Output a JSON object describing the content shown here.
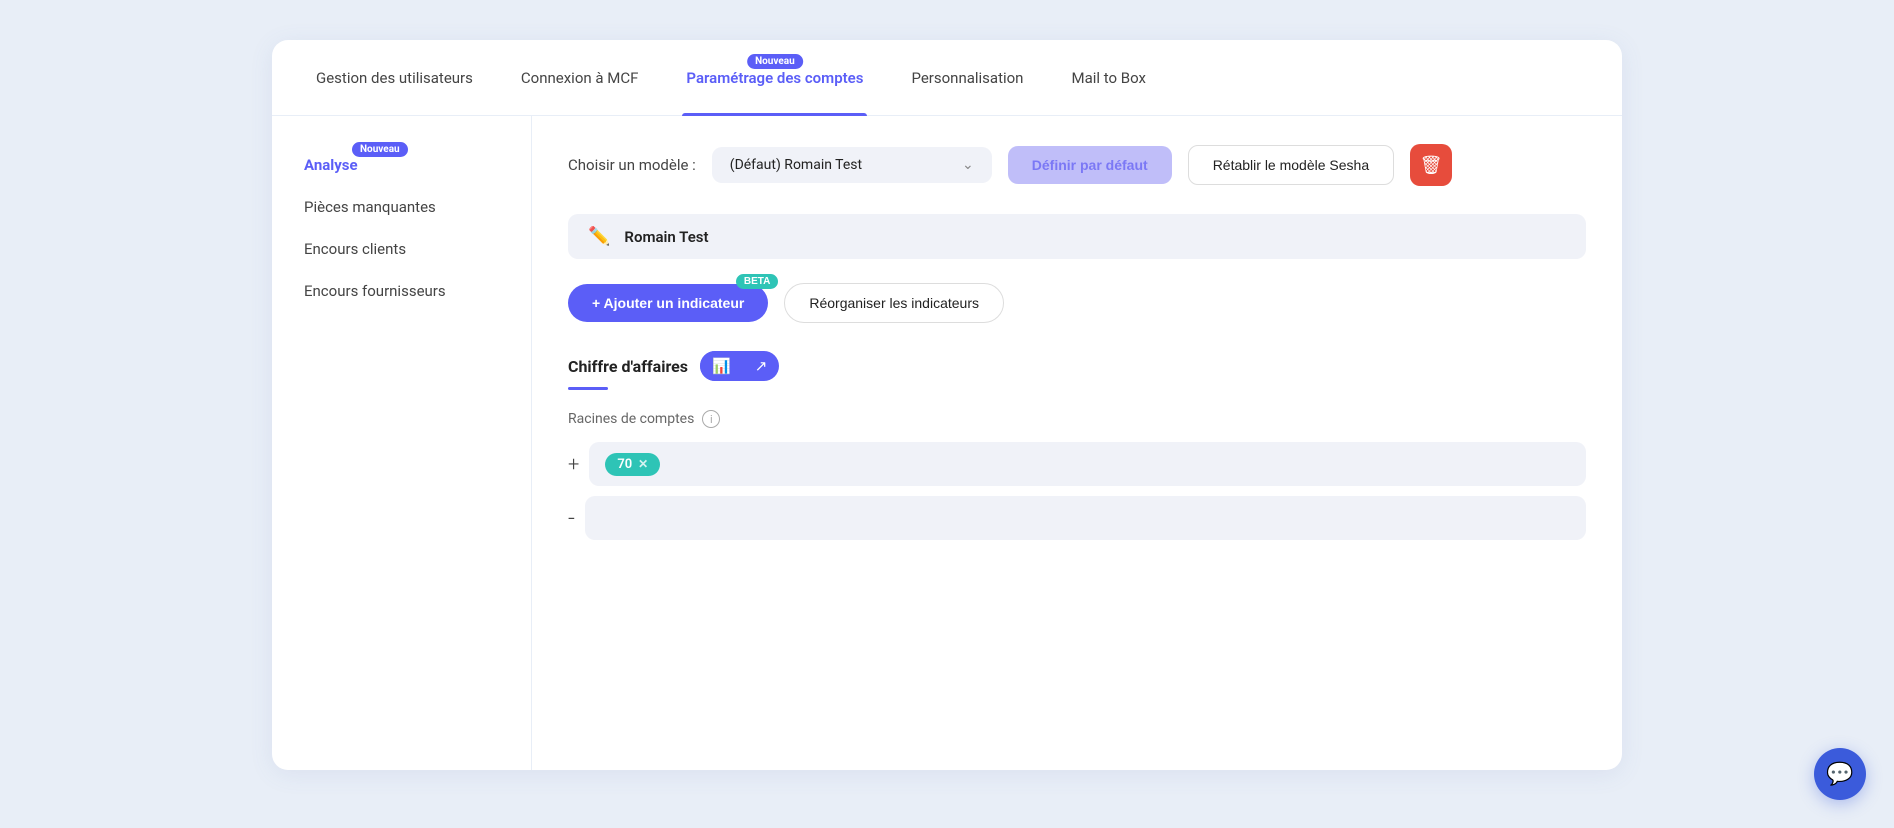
{
  "nav": {
    "items": [
      {
        "id": "gestion",
        "label": "Gestion des utilisateurs",
        "active": false,
        "badge": null
      },
      {
        "id": "connexion",
        "label": "Connexion à MCF",
        "active": false,
        "badge": null
      },
      {
        "id": "parametrage",
        "label": "Paramétrage des comptes",
        "active": true,
        "badge": "Nouveau"
      },
      {
        "id": "personnalisation",
        "label": "Personnalisation",
        "active": false,
        "badge": null
      },
      {
        "id": "mailtobox",
        "label": "Mail to Box",
        "active": false,
        "badge": null
      }
    ]
  },
  "sidebar": {
    "items": [
      {
        "id": "analyse",
        "label": "Analyse",
        "active": true,
        "badge": "Nouveau"
      },
      {
        "id": "pieces",
        "label": "Pièces manquantes",
        "active": false,
        "badge": null
      },
      {
        "id": "encours-clients",
        "label": "Encours clients",
        "active": false,
        "badge": null
      },
      {
        "id": "encours-fournisseurs",
        "label": "Encours fournisseurs",
        "active": false,
        "badge": null
      }
    ]
  },
  "model_section": {
    "label": "Choisir un modèle :",
    "selected": "(Défaut) Romain Test",
    "btn_set_default": "Définir par défaut",
    "btn_restore": "Rétablir le modèle Sesha",
    "btn_delete_icon": "🗑"
  },
  "name_field": {
    "value": "Romain Test",
    "edit_icon": "✏"
  },
  "actions": {
    "add_indicator": "+ Ajouter un indicateur",
    "add_indicator_badge": "BETA",
    "reorganize": "Réorganiser les indicateurs"
  },
  "section": {
    "title": "Chiffre d'affaires",
    "chart_btn_bar": "📊",
    "chart_btn_line": "↗",
    "underline_color": "#5b5ef7"
  },
  "racines": {
    "label": "Racines de comptes",
    "plus_label": "+",
    "tags": [
      {
        "value": "70",
        "removable": true
      }
    ],
    "minus_label": "-"
  }
}
